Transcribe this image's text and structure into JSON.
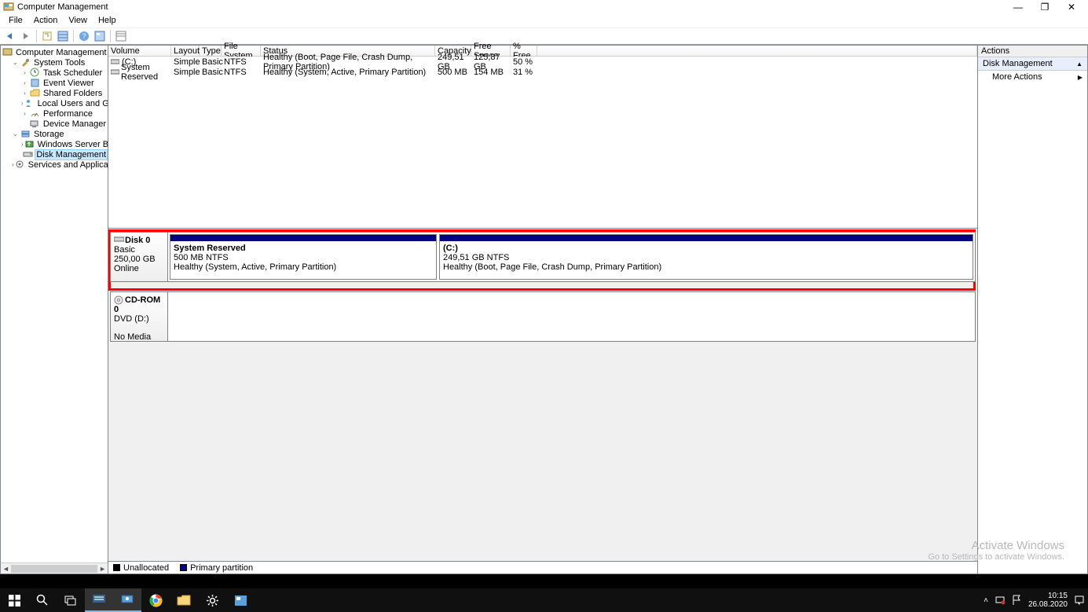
{
  "window": {
    "title": "Computer Management",
    "menus": [
      "File",
      "Action",
      "View",
      "Help"
    ],
    "win_buttons": {
      "min": "—",
      "max": "❐",
      "close": "✕"
    }
  },
  "tree": {
    "root": "Computer Management (Local",
    "system_tools": {
      "label": "System Tools",
      "children": [
        "Task Scheduler",
        "Event Viewer",
        "Shared Folders",
        "Local Users and Groups",
        "Performance",
        "Device Manager"
      ]
    },
    "storage": {
      "label": "Storage",
      "children": [
        "Windows Server Backup",
        "Disk Management"
      ]
    },
    "services": {
      "label": "Services and Applications"
    },
    "scroll": {
      "left": "◄",
      "right": "►"
    }
  },
  "volumes": {
    "headers": [
      "Volume",
      "Layout",
      "Type",
      "File System",
      "Status",
      "Capacity",
      "Free Space",
      "% Free"
    ],
    "rows": [
      {
        "name": "(C:)",
        "layout": "Simple",
        "type": "Basic",
        "fs": "NTFS",
        "status": "Healthy (Boot, Page File, Crash Dump, Primary Partition)",
        "capacity": "249,51 GB",
        "free": "125,87 GB",
        "pct": "50 %"
      },
      {
        "name": "System Reserved",
        "layout": "Simple",
        "type": "Basic",
        "fs": "NTFS",
        "status": "Healthy (System, Active, Primary Partition)",
        "capacity": "500 MB",
        "free": "154 MB",
        "pct": "31 %"
      }
    ]
  },
  "disks": {
    "disk0": {
      "name": "Disk 0",
      "type": "Basic",
      "size": "250,00 GB",
      "state": "Online",
      "partitions": [
        {
          "name": "System Reserved",
          "info": "500 MB NTFS",
          "status": "Healthy (System, Active, Primary Partition)"
        },
        {
          "name": "(C:)",
          "info": "249,51 GB NTFS",
          "status": "Healthy (Boot, Page File, Crash Dump, Primary Partition)"
        }
      ]
    },
    "cdrom": {
      "name": "CD-ROM 0",
      "type": "DVD (D:)",
      "state": "No Media"
    }
  },
  "legend": {
    "unallocated": "Unallocated",
    "primary": "Primary partition"
  },
  "actions": {
    "header": "Actions",
    "item1": "Disk Management",
    "item2": "More Actions",
    "arrow_up": "▲",
    "arrow_right": "▶"
  },
  "watermark": {
    "title": "Activate Windows",
    "sub": "Go to Settings to activate Windows."
  },
  "tray": {
    "time": "10:15",
    "date": "26.08.2020",
    "chev": "˄"
  }
}
